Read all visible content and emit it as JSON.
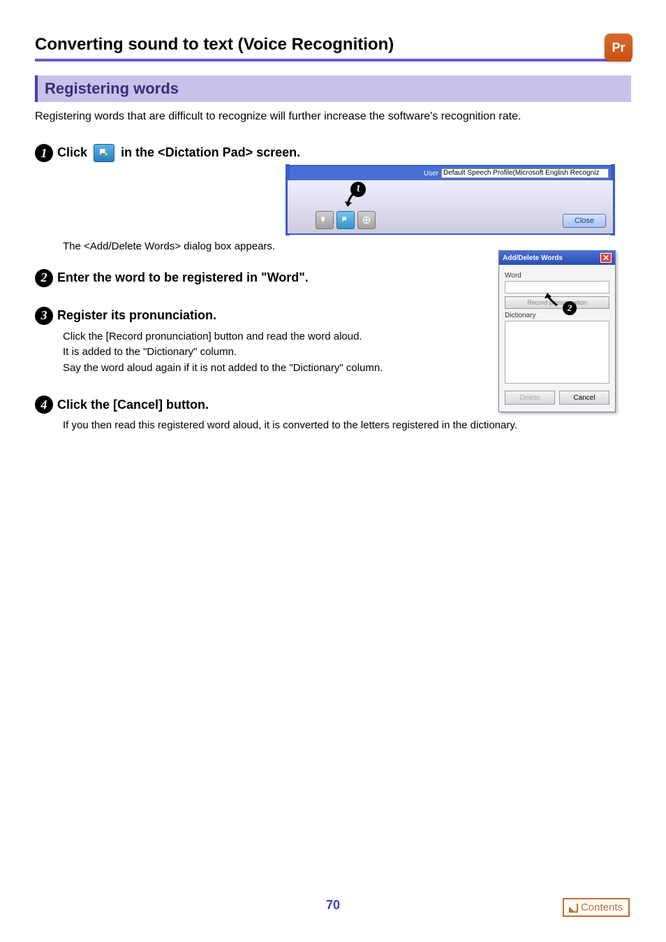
{
  "title": "Converting sound to text (Voice Recognition)",
  "pr_badge": "Pr",
  "section_heading": "Registering words",
  "intro_text": "Registering words that are difficult to recognize will further increase the software's recognition rate.",
  "steps": {
    "s1": {
      "num": "1",
      "title_before": "Click",
      "title_after": "in the <Dictation Pad> screen.",
      "body": "The <Add/Delete Words> dialog box appears."
    },
    "s2": {
      "num": "2",
      "title": "Enter the word to be registered in \"Word\"."
    },
    "s3": {
      "num": "3",
      "title": "Register its pronunciation.",
      "body1": "Click the [Record pronunciation] button and read the word aloud.",
      "body2": "It is added to the \"Dictionary\" column.",
      "body3": "Say the word aloud again if it is not added to the \"Dictionary\" column."
    },
    "s4": {
      "num": "4",
      "title": "Click the [Cancel] button.",
      "body": "If you then read this registered word aloud, it is converted to the letters registered in the dictionary."
    }
  },
  "dictation_shot": {
    "user_label": "User",
    "user_value": "Default Speech Profile(Microsoft English Recogniz",
    "close_btn": "Close",
    "callout1": "1"
  },
  "add_delete_dialog": {
    "title": "Add/Delete Words",
    "word_label": "Word",
    "record_btn": "Record pronunciation",
    "dictionary_label": "Dictionary",
    "delete_btn": "Delete",
    "cancel_btn": "Cancel",
    "callout2": "2"
  },
  "page_number": "70",
  "contents_button": "Contents"
}
